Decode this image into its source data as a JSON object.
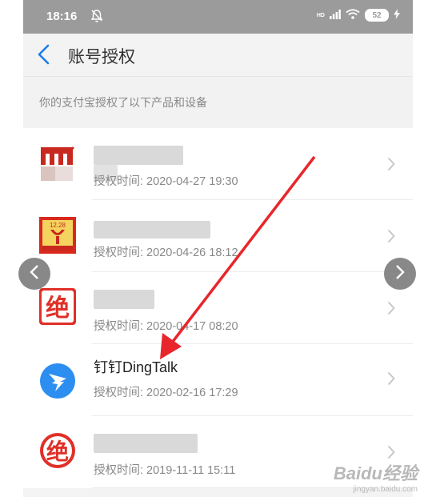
{
  "status_bar": {
    "time": "18:16",
    "network": "HD",
    "battery": "52"
  },
  "nav": {
    "title": "账号授权"
  },
  "section": {
    "label": "你的支付宝授权了以下产品和设备"
  },
  "items": [
    {
      "name": "",
      "time_label": "授权时间: 2020-04-27 19:30"
    },
    {
      "name": "",
      "time_label": "授权时间: 2020-04-26 18:12",
      "icon_text": "12.28"
    },
    {
      "name": "",
      "time_label": "授权时间: 2020-04-17 08:20",
      "icon_text": "绝"
    },
    {
      "name": "钉钉DingTalk",
      "time_label": "授权时间: 2020-02-16 17:29"
    },
    {
      "name": "",
      "time_label": "授权时间: 2019-11-11 15:11",
      "icon_text": "绝"
    }
  ],
  "watermark": {
    "brand": "Baidu经验",
    "url": "jingyan.baidu.com"
  },
  "colors": {
    "accent": "#1a7ee8",
    "arrow": "#e8262b"
  }
}
